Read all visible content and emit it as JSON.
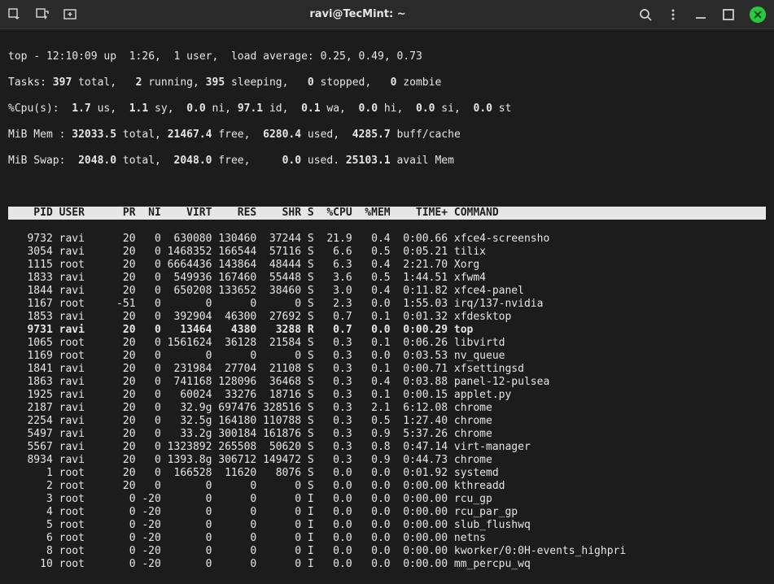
{
  "window": {
    "title": "ravi@TecMint: ~"
  },
  "summary": {
    "l1": {
      "time": "12:10:09",
      "up": "1:26",
      "users": "1 user",
      "la": "0.25, 0.49, 0.73"
    },
    "l2": {
      "total": "397",
      "running": "2",
      "sleeping": "395",
      "stopped": "0",
      "zombie": "0"
    },
    "l3": {
      "us": "1.7",
      "sy": "1.1",
      "ni": "0.0",
      "id": "97.1",
      "wa": "0.1",
      "hi": "0.0",
      "si": "0.0",
      "st": "0.0"
    },
    "l4": {
      "total": "32033.5",
      "free": "21467.4",
      "used": "6280.4",
      "buff": "4285.7"
    },
    "l5": {
      "total": "2048.0",
      "free": "2048.0",
      "used": "0.0",
      "avail": "25103.1"
    }
  },
  "columns": {
    "pid": "PID",
    "user": "USER",
    "pr": "PR",
    "ni": "NI",
    "virt": "VIRT",
    "res": "RES",
    "shr": "SHR",
    "s": "S",
    "cpu": "%CPU",
    "mem": "%MEM",
    "time": "TIME+",
    "cmd": "COMMAND"
  },
  "rows": [
    {
      "pid": "9732",
      "user": "ravi",
      "pr": "20",
      "ni": "0",
      "virt": "630080",
      "res": "130460",
      "shr": "37244",
      "s": "S",
      "cpu": "21.9",
      "mem": "0.4",
      "time": "0:00.66",
      "cmd": "xfce4-screensho"
    },
    {
      "pid": "3054",
      "user": "ravi",
      "pr": "20",
      "ni": "0",
      "virt": "1468352",
      "res": "166544",
      "shr": "57116",
      "s": "S",
      "cpu": "6.6",
      "mem": "0.5",
      "time": "0:05.21",
      "cmd": "tilix"
    },
    {
      "pid": "1115",
      "user": "root",
      "pr": "20",
      "ni": "0",
      "virt": "6664436",
      "res": "143864",
      "shr": "48444",
      "s": "S",
      "cpu": "6.3",
      "mem": "0.4",
      "time": "2:21.70",
      "cmd": "Xorg"
    },
    {
      "pid": "1833",
      "user": "ravi",
      "pr": "20",
      "ni": "0",
      "virt": "549936",
      "res": "167460",
      "shr": "55448",
      "s": "S",
      "cpu": "3.6",
      "mem": "0.5",
      "time": "1:44.51",
      "cmd": "xfwm4"
    },
    {
      "pid": "1844",
      "user": "ravi",
      "pr": "20",
      "ni": "0",
      "virt": "650208",
      "res": "133652",
      "shr": "38460",
      "s": "S",
      "cpu": "3.0",
      "mem": "0.4",
      "time": "0:11.82",
      "cmd": "xfce4-panel"
    },
    {
      "pid": "1167",
      "user": "root",
      "pr": "-51",
      "ni": "0",
      "virt": "0",
      "res": "0",
      "shr": "0",
      "s": "S",
      "cpu": "2.3",
      "mem": "0.0",
      "time": "1:55.03",
      "cmd": "irq/137-nvidia"
    },
    {
      "pid": "1853",
      "user": "ravi",
      "pr": "20",
      "ni": "0",
      "virt": "392904",
      "res": "46300",
      "shr": "27692",
      "s": "S",
      "cpu": "0.7",
      "mem": "0.1",
      "time": "0:01.32",
      "cmd": "xfdesktop"
    },
    {
      "pid": "9731",
      "user": "ravi",
      "pr": "20",
      "ni": "0",
      "virt": "13464",
      "res": "4380",
      "shr": "3288",
      "s": "R",
      "cpu": "0.7",
      "mem": "0.0",
      "time": "0:00.29",
      "cmd": "top",
      "hl": true
    },
    {
      "pid": "1065",
      "user": "root",
      "pr": "20",
      "ni": "0",
      "virt": "1561624",
      "res": "36128",
      "shr": "21584",
      "s": "S",
      "cpu": "0.3",
      "mem": "0.1",
      "time": "0:06.26",
      "cmd": "libvirtd"
    },
    {
      "pid": "1169",
      "user": "root",
      "pr": "20",
      "ni": "0",
      "virt": "0",
      "res": "0",
      "shr": "0",
      "s": "S",
      "cpu": "0.3",
      "mem": "0.0",
      "time": "0:03.53",
      "cmd": "nv_queue"
    },
    {
      "pid": "1841",
      "user": "ravi",
      "pr": "20",
      "ni": "0",
      "virt": "231984",
      "res": "27704",
      "shr": "21108",
      "s": "S",
      "cpu": "0.3",
      "mem": "0.1",
      "time": "0:00.71",
      "cmd": "xfsettingsd"
    },
    {
      "pid": "1863",
      "user": "ravi",
      "pr": "20",
      "ni": "0",
      "virt": "741168",
      "res": "128096",
      "shr": "36468",
      "s": "S",
      "cpu": "0.3",
      "mem": "0.4",
      "time": "0:03.88",
      "cmd": "panel-12-pulsea"
    },
    {
      "pid": "1925",
      "user": "ravi",
      "pr": "20",
      "ni": "0",
      "virt": "60024",
      "res": "33276",
      "shr": "18716",
      "s": "S",
      "cpu": "0.3",
      "mem": "0.1",
      "time": "0:00.15",
      "cmd": "applet.py"
    },
    {
      "pid": "2187",
      "user": "ravi",
      "pr": "20",
      "ni": "0",
      "virt": "32.9g",
      "res": "697476",
      "shr": "328516",
      "s": "S",
      "cpu": "0.3",
      "mem": "2.1",
      "time": "6:12.08",
      "cmd": "chrome"
    },
    {
      "pid": "2254",
      "user": "ravi",
      "pr": "20",
      "ni": "0",
      "virt": "32.5g",
      "res": "164180",
      "shr": "110788",
      "s": "S",
      "cpu": "0.3",
      "mem": "0.5",
      "time": "1:27.40",
      "cmd": "chrome"
    },
    {
      "pid": "5497",
      "user": "ravi",
      "pr": "20",
      "ni": "0",
      "virt": "33.2g",
      "res": "300184",
      "shr": "161876",
      "s": "S",
      "cpu": "0.3",
      "mem": "0.9",
      "time": "5:37.26",
      "cmd": "chrome"
    },
    {
      "pid": "5567",
      "user": "ravi",
      "pr": "20",
      "ni": "0",
      "virt": "1323892",
      "res": "265508",
      "shr": "50620",
      "s": "S",
      "cpu": "0.3",
      "mem": "0.8",
      "time": "0:47.14",
      "cmd": "virt-manager"
    },
    {
      "pid": "8934",
      "user": "ravi",
      "pr": "20",
      "ni": "0",
      "virt": "1393.8g",
      "res": "306712",
      "shr": "149472",
      "s": "S",
      "cpu": "0.3",
      "mem": "0.9",
      "time": "0:44.73",
      "cmd": "chrome"
    },
    {
      "pid": "1",
      "user": "root",
      "pr": "20",
      "ni": "0",
      "virt": "166528",
      "res": "11620",
      "shr": "8076",
      "s": "S",
      "cpu": "0.0",
      "mem": "0.0",
      "time": "0:01.92",
      "cmd": "systemd"
    },
    {
      "pid": "2",
      "user": "root",
      "pr": "20",
      "ni": "0",
      "virt": "0",
      "res": "0",
      "shr": "0",
      "s": "S",
      "cpu": "0.0",
      "mem": "0.0",
      "time": "0:00.00",
      "cmd": "kthreadd"
    },
    {
      "pid": "3",
      "user": "root",
      "pr": "0",
      "ni": "-20",
      "virt": "0",
      "res": "0",
      "shr": "0",
      "s": "I",
      "cpu": "0.0",
      "mem": "0.0",
      "time": "0:00.00",
      "cmd": "rcu_gp"
    },
    {
      "pid": "4",
      "user": "root",
      "pr": "0",
      "ni": "-20",
      "virt": "0",
      "res": "0",
      "shr": "0",
      "s": "I",
      "cpu": "0.0",
      "mem": "0.0",
      "time": "0:00.00",
      "cmd": "rcu_par_gp"
    },
    {
      "pid": "5",
      "user": "root",
      "pr": "0",
      "ni": "-20",
      "virt": "0",
      "res": "0",
      "shr": "0",
      "s": "I",
      "cpu": "0.0",
      "mem": "0.0",
      "time": "0:00.00",
      "cmd": "slub_flushwq"
    },
    {
      "pid": "6",
      "user": "root",
      "pr": "0",
      "ni": "-20",
      "virt": "0",
      "res": "0",
      "shr": "0",
      "s": "I",
      "cpu": "0.0",
      "mem": "0.0",
      "time": "0:00.00",
      "cmd": "netns"
    },
    {
      "pid": "8",
      "user": "root",
      "pr": "0",
      "ni": "-20",
      "virt": "0",
      "res": "0",
      "shr": "0",
      "s": "I",
      "cpu": "0.0",
      "mem": "0.0",
      "time": "0:00.00",
      "cmd": "kworker/0:0H-events_highpri"
    },
    {
      "pid": "10",
      "user": "root",
      "pr": "0",
      "ni": "-20",
      "virt": "0",
      "res": "0",
      "shr": "0",
      "s": "I",
      "cpu": "0.0",
      "mem": "0.0",
      "time": "0:00.00",
      "cmd": "mm_percpu_wq"
    }
  ]
}
